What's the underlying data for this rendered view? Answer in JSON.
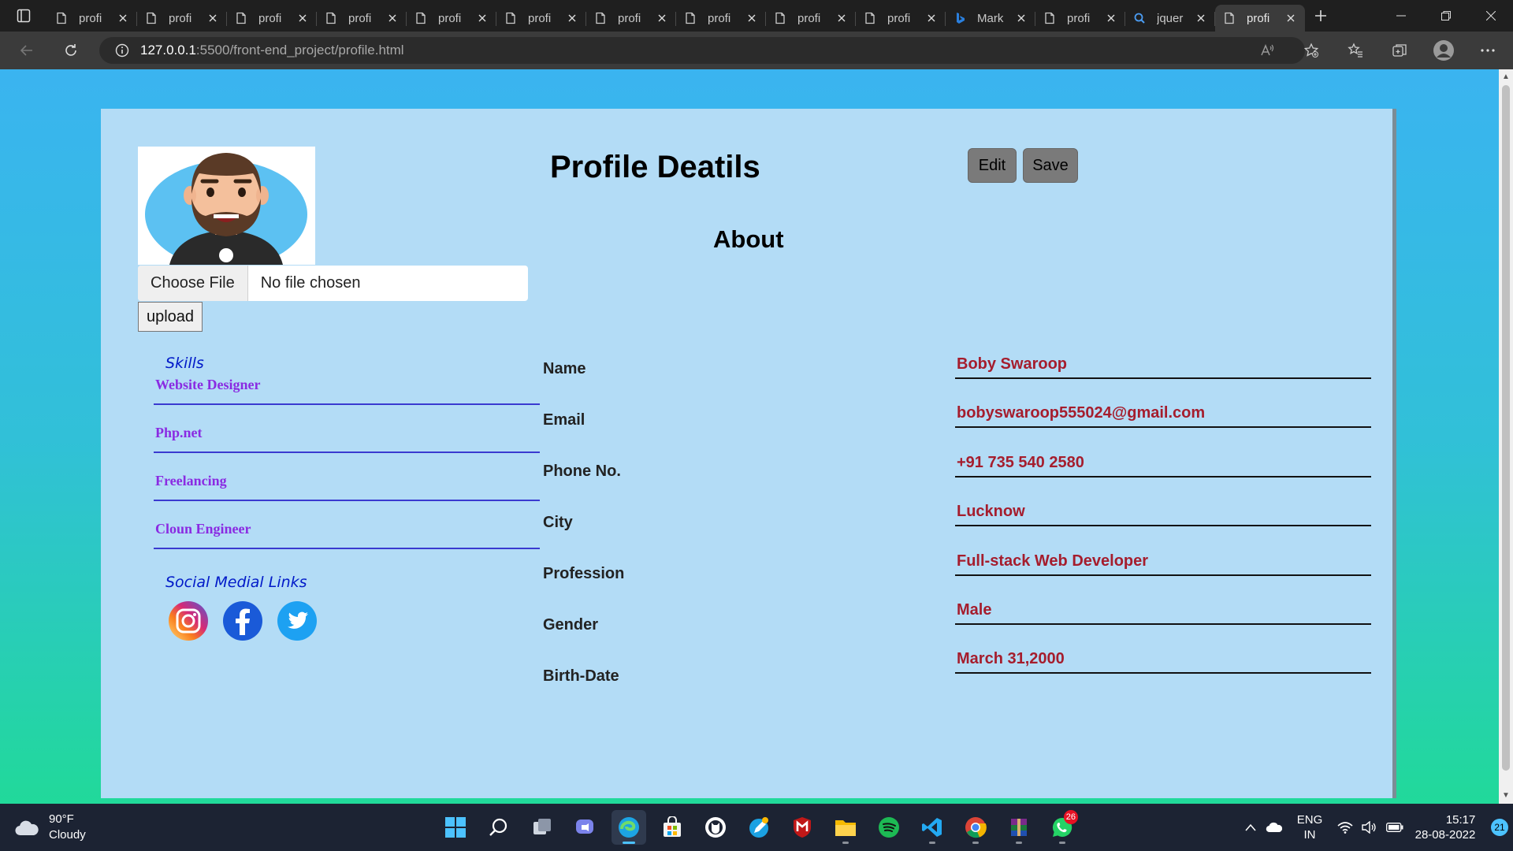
{
  "browser": {
    "tabs": [
      {
        "label": "profi",
        "icon": "page-icon"
      },
      {
        "label": "profi",
        "icon": "page-icon"
      },
      {
        "label": "profi",
        "icon": "page-icon"
      },
      {
        "label": "profi",
        "icon": "page-icon"
      },
      {
        "label": "profi",
        "icon": "page-icon"
      },
      {
        "label": "profi",
        "icon": "page-icon"
      },
      {
        "label": "profi",
        "icon": "page-icon"
      },
      {
        "label": "profi",
        "icon": "page-icon"
      },
      {
        "label": "profi",
        "icon": "page-icon"
      },
      {
        "label": "profi",
        "icon": "page-icon"
      },
      {
        "label": "Mark",
        "icon": "bing-icon"
      },
      {
        "label": "profi",
        "icon": "page-icon"
      },
      {
        "label": "jquer",
        "icon": "search-icon"
      },
      {
        "label": "profi",
        "icon": "page-icon",
        "active": true
      }
    ],
    "url_host": "127.0.0.1",
    "url_path": ":5500/front-end_project/profile.html"
  },
  "page": {
    "title": "Profile Deatils",
    "edit_label": "Edit",
    "save_label": "Save",
    "about_title": "About",
    "file_button": "Choose File",
    "file_status": "No file chosen",
    "upload_label": "upload",
    "skills_heading": "Skills",
    "skills": [
      "Website Designer",
      "Php.net",
      "Freelancing",
      "Cloun Engineer"
    ],
    "social_heading": "Social Medial Links",
    "social_icons": [
      "instagram-icon",
      "facebook-icon",
      "twitter-icon"
    ],
    "fields": [
      {
        "label": "Name",
        "value": "Boby Swaroop"
      },
      {
        "label": "Email",
        "value": "bobyswaroop555024@gmail.com"
      },
      {
        "label": "Phone No.",
        "value": "+91 735 540 2580"
      },
      {
        "label": "City",
        "value": "Lucknow"
      },
      {
        "label": "Profession",
        "value": "Full-stack Web Developer"
      },
      {
        "label": "Gender",
        "value": "Male"
      },
      {
        "label": "Birth-Date",
        "value": "March 31,2000"
      }
    ]
  },
  "taskbar": {
    "weather_temp": "90°F",
    "weather_desc": "Cloudy",
    "whatsapp_badge": "26",
    "lang_line1": "ENG",
    "lang_line2": "IN",
    "time": "15:17",
    "date": "28-08-2022",
    "notification_count": "21"
  },
  "colors": {
    "page_gradient_top": "#3ab4f0",
    "page_gradient_bottom": "#21d99a",
    "card_background": "#b3dcf6",
    "skill_text": "#8a2be2",
    "field_value_text": "#a51d2d",
    "heading_link_blue": "#0019c8"
  }
}
